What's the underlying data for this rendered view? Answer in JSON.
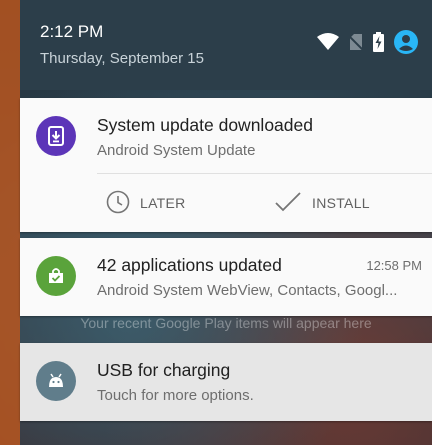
{
  "header": {
    "time": "2:12 PM",
    "date": "Thursday, September 15",
    "icons": [
      "wifi-icon",
      "no-sim-icon",
      "battery-charging-icon",
      "account-icon"
    ]
  },
  "notifications": [
    {
      "title": "System update downloaded",
      "subtitle": "Android System Update",
      "icon": "system-update-icon",
      "icon_color": "#5c35b8",
      "actions": [
        {
          "label": "LATER",
          "icon": "clock-icon"
        },
        {
          "label": "INSTALL",
          "icon": "check-icon"
        }
      ]
    },
    {
      "title": "42 applications updated",
      "subtitle": "Android System WebView, Contacts, Googl...",
      "time": "12:58 PM",
      "icon": "play-store-updates-icon",
      "icon_color": "#5aa33b"
    },
    {
      "title": "USB for charging",
      "subtitle": "Touch for more options.",
      "icon": "android-icon",
      "icon_color": "#607d8b"
    }
  ],
  "colors": {
    "header_bg": "#2c3e4a",
    "account_icon": "#29b6f6",
    "card_bg": "#fafafa"
  }
}
